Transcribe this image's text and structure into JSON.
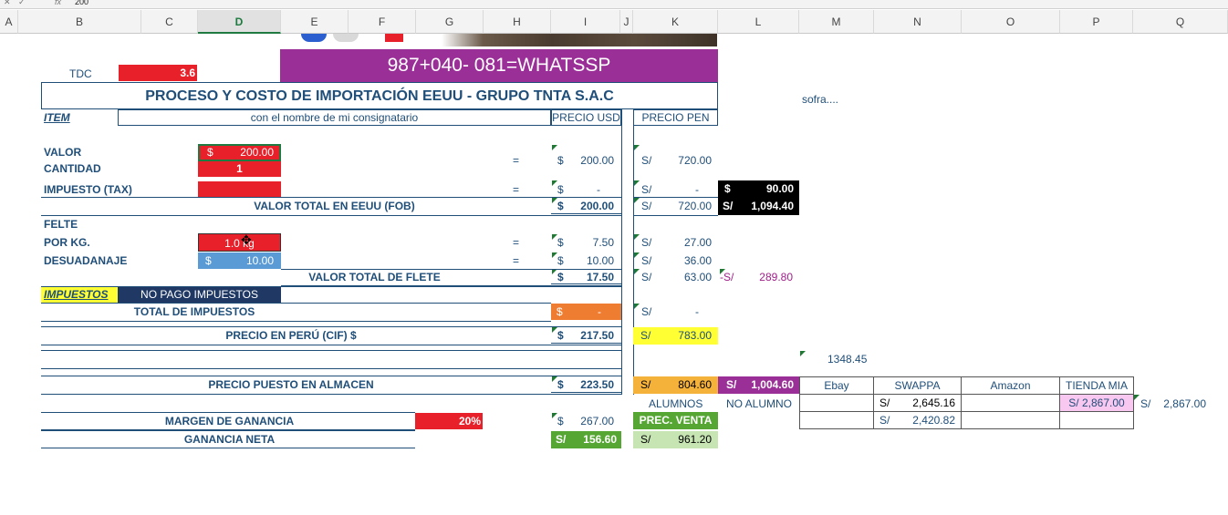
{
  "formula_bar": {
    "fx": "fx",
    "value": "200"
  },
  "columns": [
    "A",
    "B",
    "C",
    "D",
    "E",
    "F",
    "G",
    "H",
    "I",
    "J",
    "K",
    "L",
    "M",
    "N",
    "O",
    "P",
    "Q"
  ],
  "banner": "987+040- 081=WHATSSP",
  "tdc": {
    "label": "TDC",
    "value": "3.6"
  },
  "title": "PROCESO Y COSTO DE IMPORTACIÓN EEUU - GRUPO TNTA S.A.C",
  "sofra": "sofra....",
  "header_row": {
    "item": "ITEM",
    "consignee": "con el nombre de mi consignatario",
    "usd": "PRECIO USD",
    "pen": "PRECIO PEN"
  },
  "rows": {
    "valor": {
      "label": "VALOR",
      "input_cur": "$",
      "input_val": "200.00",
      "eq": "=",
      "usd_cur": "$",
      "usd": "200.00",
      "pen_cur": "S/",
      "pen": "720.00"
    },
    "cantidad": {
      "label": "CANTIDAD",
      "input": "1"
    },
    "impuesto": {
      "label": "IMPUESTO (TAX)",
      "eq": "=",
      "usd_cur": "$",
      "usd": "-",
      "pen_cur": "S/",
      "pen": "-",
      "extra_cur": "$",
      "extra": "90.00"
    },
    "fob": {
      "label": "VALOR TOTAL EN EEUU (FOB)",
      "usd_cur": "$",
      "usd": "200.00",
      "pen_cur": "S/",
      "pen": "720.00",
      "extra_cur": "S/",
      "extra": "1,094.40"
    },
    "felte": {
      "label": "FELTE"
    },
    "porkg": {
      "label": "POR KG.",
      "input": "1.0 kg",
      "eq": "=",
      "usd_cur": "$",
      "usd": "7.50",
      "pen_cur": "S/",
      "pen": "27.00"
    },
    "desuadanaje": {
      "label": "DESUADANAJE",
      "input_cur": "$",
      "input_val": "10.00",
      "eq": "=",
      "usd_cur": "$",
      "usd": "10.00",
      "pen_cur": "S/",
      "pen": "36.00"
    },
    "flete_total": {
      "label": "VALOR TOTAL DE FLETE",
      "usd_cur": "$",
      "usd": "17.50",
      "pen_cur": "S/",
      "pen": "63.00",
      "extra_cur": "-S/",
      "extra": "289.80"
    },
    "impuestos": {
      "label": "IMPUESTOS",
      "note": "NO PAGO IMPUESTOS"
    },
    "total_impuestos": {
      "label": "TOTAL DE IMPUESTOS",
      "usd_cur": "$",
      "usd": "-",
      "pen_cur": "S/",
      "pen": "-"
    },
    "cif": {
      "label": "PRECIO EN PERÚ  (CIF) $",
      "usd_cur": "$",
      "usd": "217.50",
      "pen_cur": "S/",
      "pen": "783.00"
    },
    "extra_value": "1348.45",
    "almacen": {
      "label": "PRECIO PUESTO EN ALMACEN",
      "usd_cur": "$",
      "usd": "223.50",
      "pen_cur": "S/",
      "pen": "804.60",
      "extra_cur": "S/",
      "extra": "1,004.60"
    },
    "alumnos": {
      "a": "ALUMNOS",
      "b": "NO ALUMNO"
    },
    "margen": {
      "label": "MARGEN DE GANANCIA",
      "pct": "20%",
      "usd_cur": "$",
      "usd": "267.00",
      "prec_venta": "PREC. VENTA"
    },
    "ganancia": {
      "label": "GANANCIA NETA",
      "usd_cur": "S/",
      "usd": "156.60",
      "pen_cur": "S/",
      "pen": "961.20"
    }
  },
  "market": {
    "headers": [
      "Ebay",
      "SWAPPA",
      "Amazon",
      "TIENDA MIA"
    ],
    "swappa1_cur": "S/",
    "swappa1": "2,645.16",
    "swappa2_cur": "S/",
    "swappa2": "2,420.82",
    "tienda": "S/ 2,867.00",
    "outside_cur": "S/",
    "outside": "2,867.00"
  },
  "colors": {
    "red": "#e8202a",
    "purple": "#9a2f97",
    "blue_input": "#5b9bd5",
    "navy": "#1f3864",
    "orange": "#ee7d31",
    "yellow": "#ffff33",
    "green": "#56a634",
    "light_green": "#c6e5b3",
    "gold": "#f4b23a",
    "black": "#000000",
    "magenta_text": "#a0208a"
  }
}
